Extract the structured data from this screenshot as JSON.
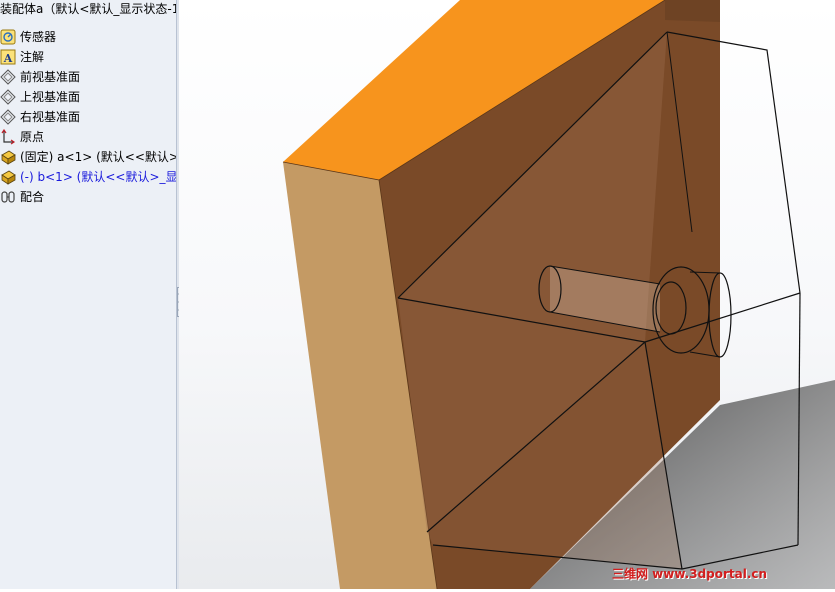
{
  "tree": {
    "title": "装配体a（默认<默认_显示状态-1",
    "items": [
      {
        "label": "传感器",
        "icon": "sensor-icon"
      },
      {
        "label": "注解",
        "icon": "annotation-icon"
      },
      {
        "label": "前视基准面",
        "icon": "plane-icon"
      },
      {
        "label": "上视基准面",
        "icon": "plane-icon"
      },
      {
        "label": "右视基准面",
        "icon": "plane-icon"
      },
      {
        "label": "原点",
        "icon": "origin-icon"
      },
      {
        "label": "(固定) a<1> (默认<<默认>_",
        "icon": "part-icon"
      },
      {
        "label": "(-) b<1> (默认<<默认>_显示",
        "icon": "part-icon",
        "color": "#1a1adc"
      },
      {
        "label": "配合",
        "icon": "mates-icon"
      }
    ]
  },
  "watermark": "三维网 www.3dportal.cn",
  "colors": {
    "part_top": "#f7941d",
    "part_side": "#c49a64",
    "part_front": "#7a4a28",
    "tree_bg": "#ecf0f6",
    "selected_text": "#1a1adc"
  }
}
